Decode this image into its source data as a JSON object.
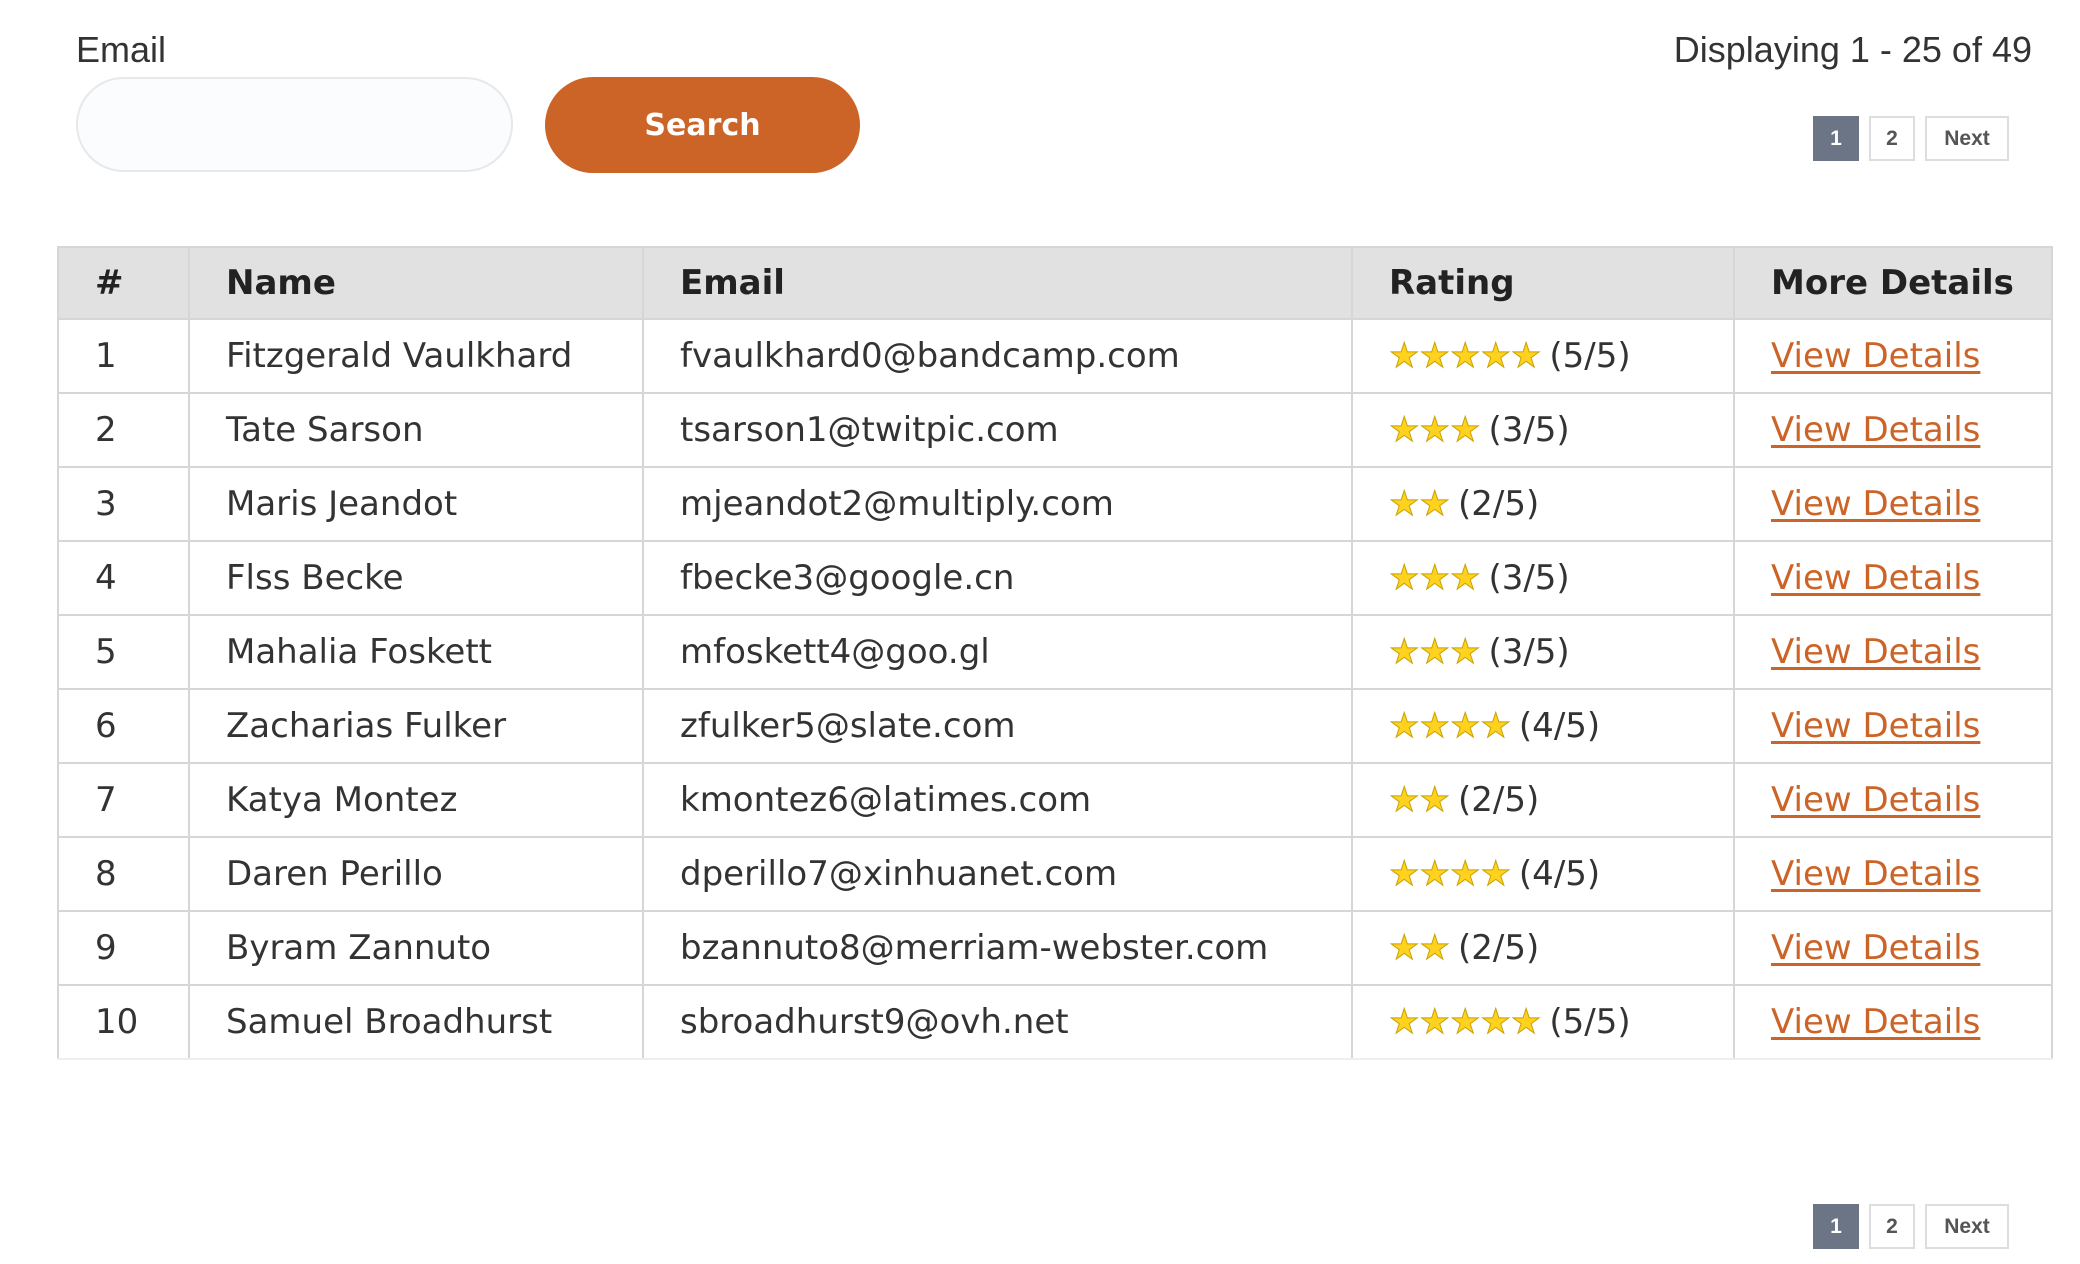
{
  "search": {
    "label": "Email",
    "value": "",
    "placeholder": "",
    "button_label": "Search"
  },
  "pagination": {
    "summary": "Displaying 1 - 25 of 49",
    "pages": [
      "1",
      "2"
    ],
    "current": "1",
    "next_label": "Next"
  },
  "table": {
    "columns": [
      "#",
      "Name",
      "Email",
      "Rating",
      "More Details"
    ],
    "rows": [
      {
        "index": "1",
        "name": "Fitzgerald Vaulkhard",
        "email": "fvaulkhard0@bandcamp.com",
        "rating": 5,
        "rating_text": "(5/5)",
        "link": "View Details"
      },
      {
        "index": "2",
        "name": "Tate Sarson",
        "email": "tsarson1@twitpic.com",
        "rating": 3,
        "rating_text": "(3/5)",
        "link": "View Details"
      },
      {
        "index": "3",
        "name": "Maris Jeandot",
        "email": "mjeandot2@multiply.com",
        "rating": 2,
        "rating_text": "(2/5)",
        "link": "View Details"
      },
      {
        "index": "4",
        "name": "Flss Becke",
        "email": "fbecke3@google.cn",
        "rating": 3,
        "rating_text": "(3/5)",
        "link": "View Details"
      },
      {
        "index": "5",
        "name": "Mahalia Foskett",
        "email": "mfoskett4@goo.gl",
        "rating": 3,
        "rating_text": "(3/5)",
        "link": "View Details"
      },
      {
        "index": "6",
        "name": "Zacharias Fulker",
        "email": "zfulker5@slate.com",
        "rating": 4,
        "rating_text": "(4/5)",
        "link": "View Details"
      },
      {
        "index": "7",
        "name": "Katya Montez",
        "email": "kmontez6@latimes.com",
        "rating": 2,
        "rating_text": "(2/5)",
        "link": "View Details"
      },
      {
        "index": "8",
        "name": "Daren Perillo",
        "email": "dperillo7@xinhuanet.com",
        "rating": 4,
        "rating_text": "(4/5)",
        "link": "View Details"
      },
      {
        "index": "9",
        "name": "Byram Zannuto",
        "email": "bzannuto8@merriam-webster.com",
        "rating": 2,
        "rating_text": "(2/5)",
        "link": "View Details"
      },
      {
        "index": "10",
        "name": "Samuel Broadhurst",
        "email": "sbroadhurst9@ovh.net",
        "rating": 5,
        "rating_text": "(5/5)",
        "link": "View Details"
      }
    ]
  },
  "colors": {
    "accent": "#cc6428",
    "active_page": "#6b7585",
    "header_bg": "#e1e1e1",
    "star": "#ffd21f"
  },
  "icons": {
    "rating": "star-icon"
  }
}
